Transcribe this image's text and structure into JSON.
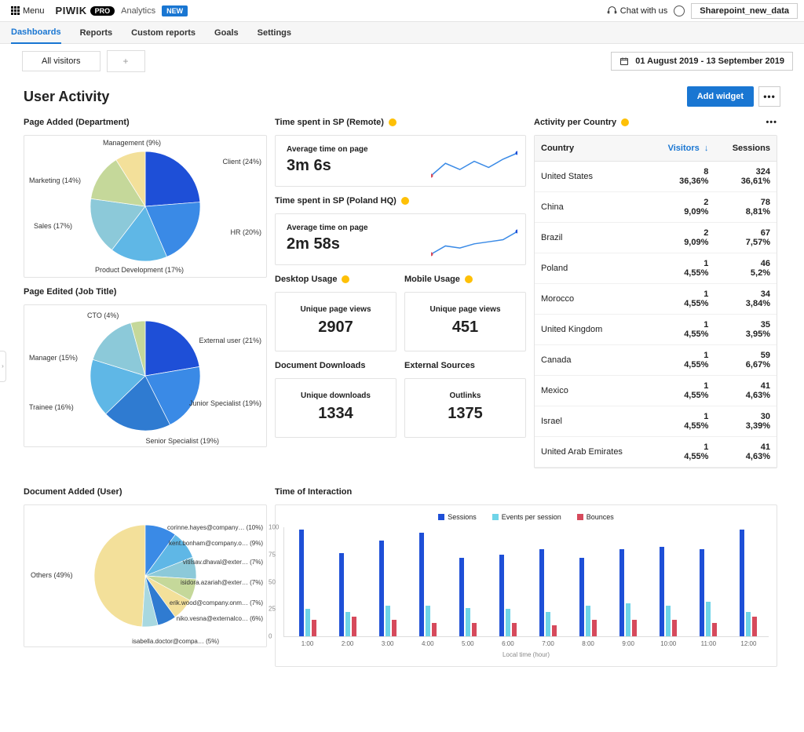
{
  "topbar": {
    "menu": "Menu",
    "brand": "PIWIK",
    "pro": "PRO",
    "product": "Analytics",
    "new": "NEW",
    "chat": "Chat with us",
    "project": "Sharepoint_new_data"
  },
  "nav": {
    "items": [
      "Dashboards",
      "Reports",
      "Custom reports",
      "Goals",
      "Settings"
    ],
    "active": 0
  },
  "subbar": {
    "tab": "All visitors",
    "date_range": "01 August 2019 - 13 September 2019"
  },
  "page": {
    "title": "User Activity",
    "add_widget": "Add widget"
  },
  "widgets": {
    "page_added": {
      "title": "Page Added (Department)"
    },
    "page_edited": {
      "title": "Page Edited (Job Title)"
    },
    "doc_added": {
      "title": "Document Added (User)"
    },
    "time_remote": {
      "title": "Time spent in SP (Remote)",
      "label": "Average time on page",
      "value": "3m 6s"
    },
    "time_poland": {
      "title": "Time spent in SP (Poland HQ)",
      "label": "Average time on page",
      "value": "2m 58s"
    },
    "desktop": {
      "title": "Desktop Usage",
      "label": "Unique page views",
      "value": "2907"
    },
    "mobile": {
      "title": "Mobile Usage",
      "label": "Unique page views",
      "value": "451"
    },
    "downloads": {
      "title": "Document Downloads",
      "label": "Unique downloads",
      "value": "1334"
    },
    "external": {
      "title": "External Sources",
      "label": "Outlinks",
      "value": "1375"
    },
    "country": {
      "title": "Activity per Country",
      "headers": [
        "Country",
        "Visitors",
        "Sessions"
      ],
      "rows": [
        {
          "country": "United States",
          "visitors": "8",
          "vpct": "36,36%",
          "sessions": "324",
          "spct": "36,61%"
        },
        {
          "country": "China",
          "visitors": "2",
          "vpct": "9,09%",
          "sessions": "78",
          "spct": "8,81%"
        },
        {
          "country": "Brazil",
          "visitors": "2",
          "vpct": "9,09%",
          "sessions": "67",
          "spct": "7,57%"
        },
        {
          "country": "Poland",
          "visitors": "1",
          "vpct": "4,55%",
          "sessions": "46",
          "spct": "5,2%"
        },
        {
          "country": "Morocco",
          "visitors": "1",
          "vpct": "4,55%",
          "sessions": "34",
          "spct": "3,84%"
        },
        {
          "country": "United Kingdom",
          "visitors": "1",
          "vpct": "4,55%",
          "sessions": "35",
          "spct": "3,95%"
        },
        {
          "country": "Canada",
          "visitors": "1",
          "vpct": "4,55%",
          "sessions": "59",
          "spct": "6,67%"
        },
        {
          "country": "Mexico",
          "visitors": "1",
          "vpct": "4,55%",
          "sessions": "41",
          "spct": "4,63%"
        },
        {
          "country": "Israel",
          "visitors": "1",
          "vpct": "4,55%",
          "sessions": "30",
          "spct": "3,39%"
        },
        {
          "country": "United Arab Emirates",
          "visitors": "1",
          "vpct": "4,55%",
          "sessions": "41",
          "spct": "4,63%"
        }
      ]
    },
    "interaction": {
      "title": "Time of Interaction",
      "legend": [
        "Sessions",
        "Events per session",
        "Bounces"
      ],
      "xlabel": "Local time (hour)"
    }
  },
  "chart_data": [
    {
      "type": "pie",
      "title": "Page Added (Department)",
      "categories": [
        "Client",
        "HR",
        "Product Development",
        "Sales",
        "Marketing",
        "Management"
      ],
      "values": [
        24,
        20,
        17,
        17,
        14,
        9
      ],
      "colors": [
        "#1e4fd7",
        "#3a8ae6",
        "#5fb7e6",
        "#8cc9d9",
        "#c5d89a",
        "#f3e09a"
      ]
    },
    {
      "type": "pie",
      "title": "Page Edited (Job Title)",
      "categories": [
        "External user",
        "Junior Specialist",
        "Senior Specialist",
        "Trainee",
        "Manager",
        "CTO"
      ],
      "values": [
        21,
        19,
        19,
        16,
        15,
        4
      ],
      "label_suffixes": [
        "(21%)",
        "(19%)",
        "(19%)",
        "(16%)",
        "(15%)",
        "(4%)"
      ],
      "unaccounted_pct": 6,
      "colors": [
        "#1e4fd7",
        "#3a8ae6",
        "#2f7bd1",
        "#5fb7e6",
        "#8cc9d9",
        "#c5d89a"
      ]
    },
    {
      "type": "pie",
      "title": "Document Added (User)",
      "categories": [
        "Others",
        "corinne.hayes@company… (10%)",
        "kent.bonham@company.o… (9%)",
        "vitilsav.dhaval@exter… (7%)",
        "isidora.azariah@exter… (7%)",
        "erik.wood@company.onm… (7%)",
        "niko.vesna@externalco… (6%)",
        "isabella.doctor@compa… (5%)"
      ],
      "values": [
        49,
        10,
        9,
        7,
        7,
        7,
        6,
        5
      ]
    },
    {
      "type": "line",
      "title": "Time spent in SP (Remote) sparkline",
      "x": [
        0,
        1,
        2,
        3,
        4,
        5,
        6
      ],
      "values": [
        4,
        16,
        10,
        18,
        12,
        20,
        26
      ]
    },
    {
      "type": "line",
      "title": "Time spent in SP (Poland HQ) sparkline",
      "x": [
        0,
        1,
        2,
        3,
        4,
        5,
        6
      ],
      "values": [
        4,
        12,
        10,
        14,
        16,
        18,
        26
      ]
    },
    {
      "type": "bar",
      "title": "Time of Interaction",
      "categories": [
        "1:00",
        "2:00",
        "3:00",
        "4:00",
        "5:00",
        "6:00",
        "7:00",
        "8:00",
        "9:00",
        "10:00",
        "11:00",
        "12:00"
      ],
      "series": [
        {
          "name": "Sessions",
          "color": "#1e4fd7",
          "values": [
            98,
            76,
            88,
            95,
            72,
            75,
            80,
            72,
            80,
            82,
            80,
            98
          ]
        },
        {
          "name": "Events per session",
          "color": "#6fd4e8",
          "values": [
            25,
            22,
            28,
            28,
            26,
            25,
            22,
            28,
            30,
            28,
            32,
            22
          ]
        },
        {
          "name": "Bounces",
          "color": "#d64a5c",
          "values": [
            15,
            18,
            15,
            12,
            12,
            12,
            10,
            15,
            15,
            15,
            12,
            18
          ]
        }
      ],
      "ylim": [
        0,
        100
      ],
      "yticks": [
        0,
        25,
        50,
        75,
        100
      ],
      "xlabel": "Local time (hour)"
    }
  ]
}
